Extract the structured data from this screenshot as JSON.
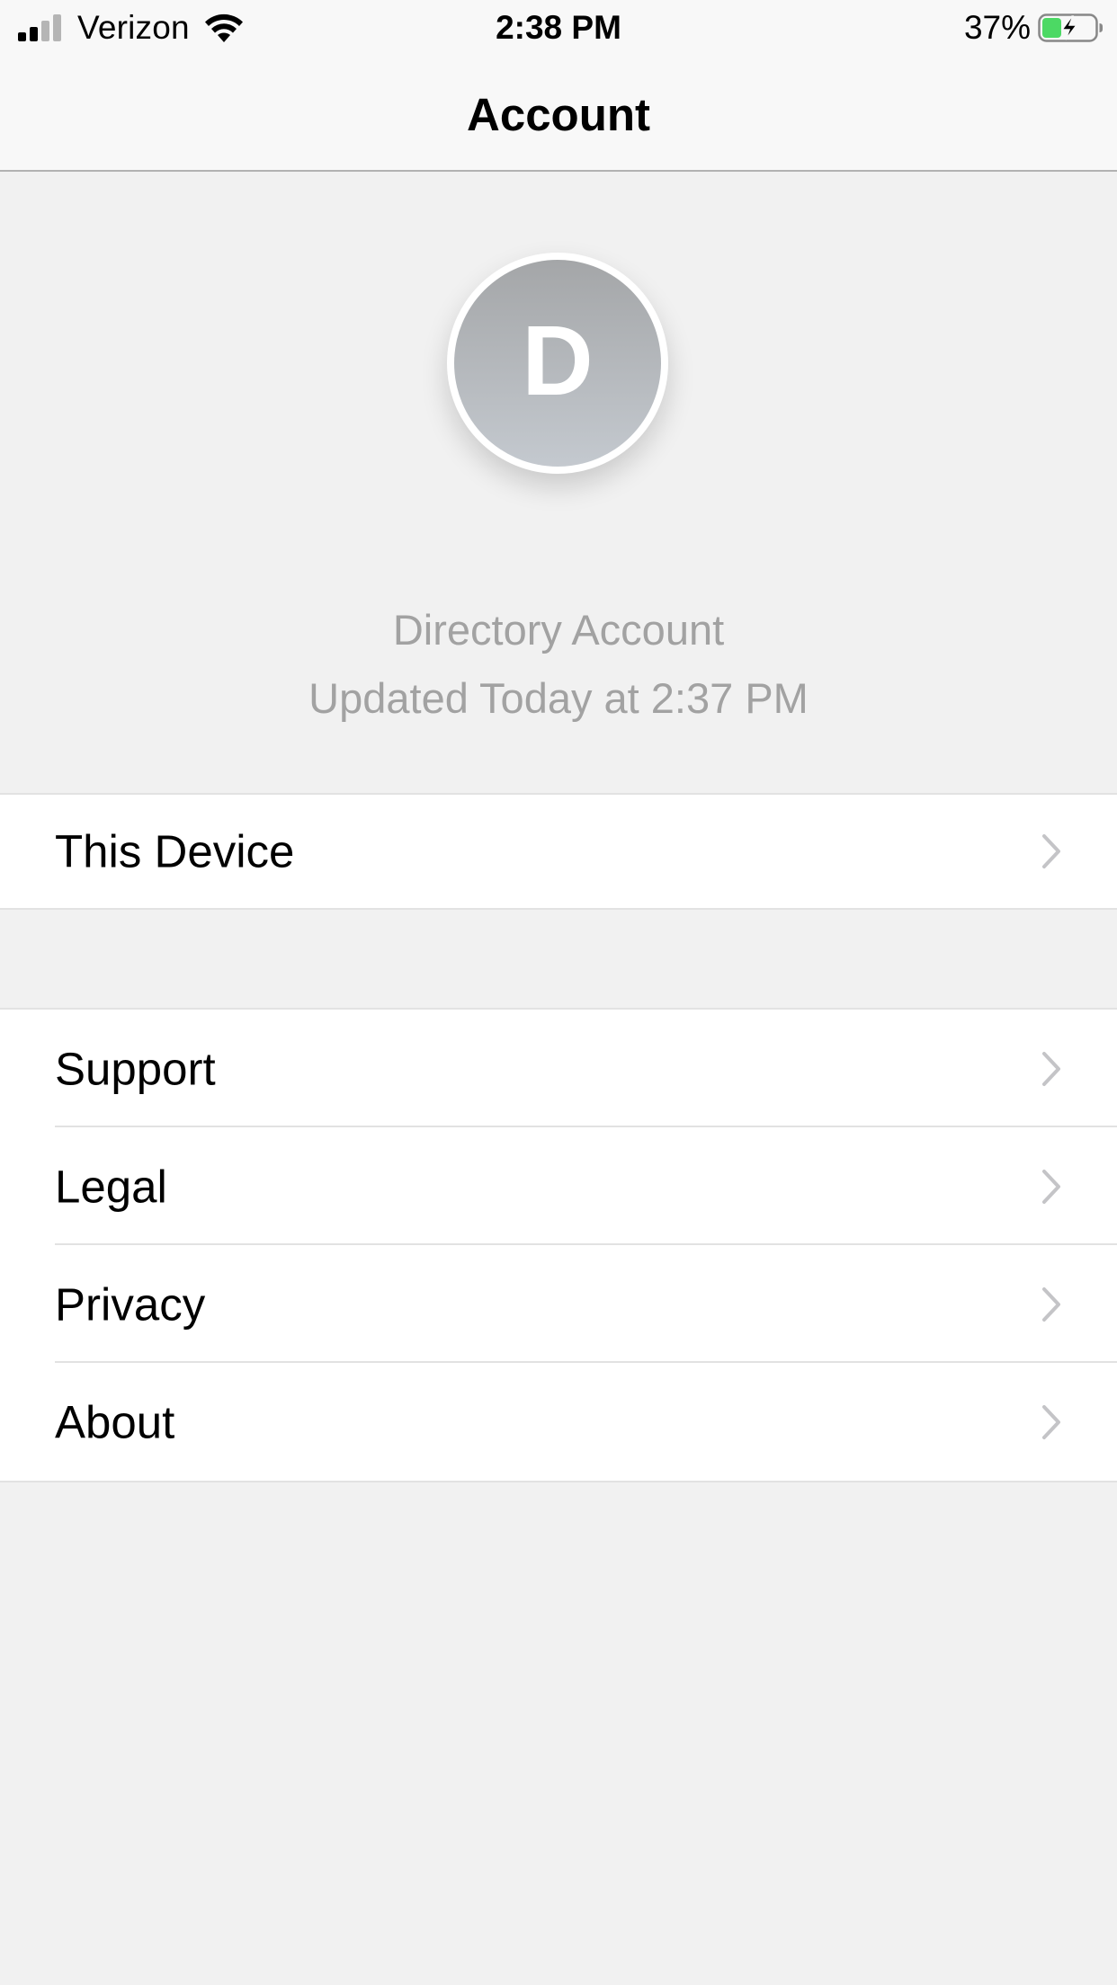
{
  "status_bar": {
    "carrier": "Verizon",
    "time": "2:38 PM",
    "battery_percent": "37%",
    "signal_bars_active": 2,
    "signal_bars_total": 4,
    "charging": true,
    "battery_level": 0.37,
    "colors": {
      "battery_fill": "#4cd964"
    }
  },
  "nav": {
    "title": "Account"
  },
  "profile": {
    "initial": "D",
    "name": "Directory Account",
    "updated": "Updated Today at 2:37 PM"
  },
  "groups": [
    {
      "rows": [
        {
          "label": "This Device"
        }
      ]
    },
    {
      "rows": [
        {
          "label": "Support"
        },
        {
          "label": "Legal"
        },
        {
          "label": "Privacy"
        },
        {
          "label": "About"
        }
      ]
    }
  ],
  "icons": {
    "row_accessory": "chevron-right-icon",
    "status": [
      "signal-icon",
      "wifi-icon",
      "battery-icon"
    ]
  }
}
